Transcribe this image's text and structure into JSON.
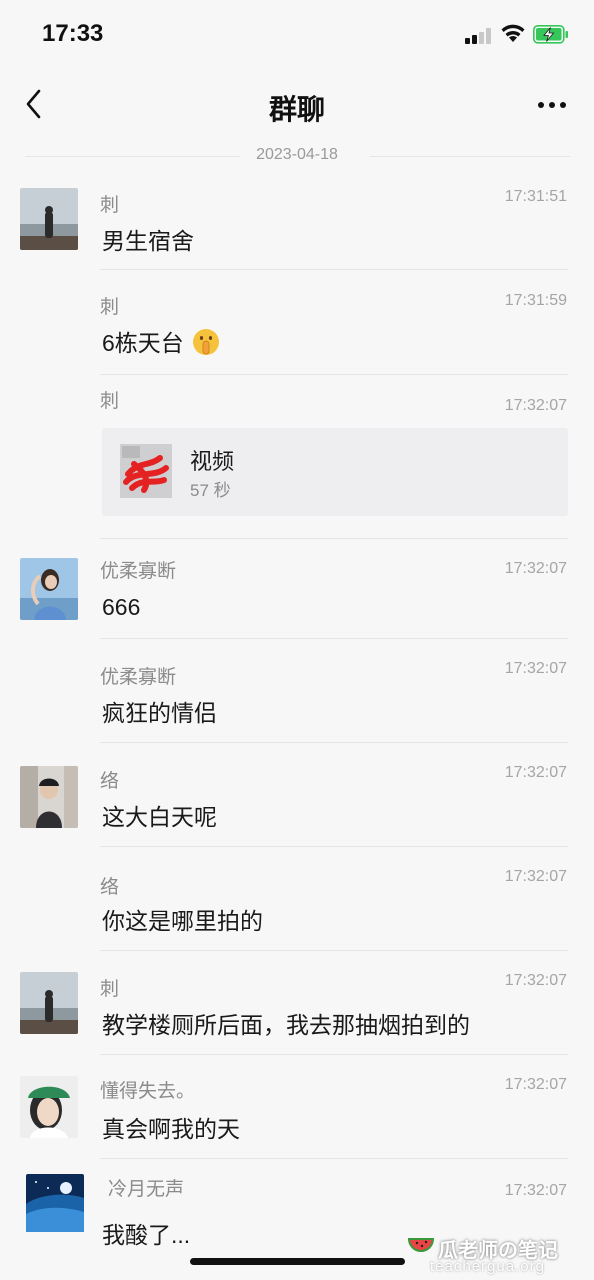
{
  "status_bar": {
    "time": "17:33"
  },
  "nav": {
    "title": "群聊"
  },
  "date_separator": "2023-04-18",
  "messages": [
    {
      "sender": "刺",
      "time": "17:31:51",
      "text": "男生宿舍",
      "avatar": "avatar-person-seaside"
    },
    {
      "sender": "刺",
      "time": "17:31:59",
      "text": "6栋天台",
      "emoji": "shushing-face-emoji"
    },
    {
      "sender": "刺",
      "time": "17:32:07",
      "type": "video",
      "video": {
        "title": "视频",
        "duration": "57 秒"
      }
    },
    {
      "sender": "优柔寡断",
      "time": "17:32:07",
      "text": "666",
      "avatar": "avatar-girl-blue"
    },
    {
      "sender": "优柔寡断",
      "time": "17:32:07",
      "text": "疯狂的情侣"
    },
    {
      "sender": "络",
      "time": "17:32:07",
      "text": "这大白天呢",
      "avatar": "avatar-person-cap"
    },
    {
      "sender": "络",
      "time": "17:32:07",
      "text": "你这是哪里拍的"
    },
    {
      "sender": "刺",
      "time": "17:32:07",
      "text": "教学楼厕所后面，我去那抽烟拍到的",
      "avatar": "avatar-person-seaside"
    },
    {
      "sender": "懂得失去。",
      "time": "17:32:07",
      "text": "真会啊我的天",
      "avatar": "avatar-person-green-cap"
    },
    {
      "sender": "冷月无声",
      "time": "17:32:07",
      "text": "我酸了...",
      "avatar": "avatar-moon-night"
    }
  ],
  "watermark": {
    "text": "瓜老师の笔记",
    "site": "teachergua.org"
  },
  "colors": {
    "background": "#f7f7f8",
    "text": "#1a1a1a",
    "muted": "#8b8b8b",
    "battery_green": "#35c759"
  }
}
